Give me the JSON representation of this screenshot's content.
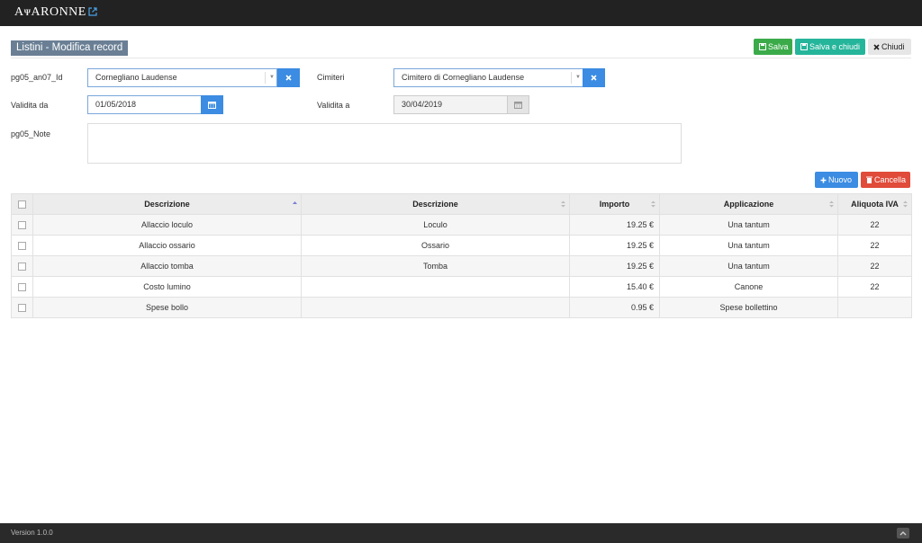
{
  "app": {
    "logo": "AᴪARONNE",
    "version": "Version 1.0.0"
  },
  "page": {
    "title": "Listini - Modifica record"
  },
  "toolbar": {
    "save_label": "Salva",
    "save_close_label": "Salva e chiudi",
    "close_label": "Chiudi"
  },
  "form": {
    "an07_label": "pg05_an07_Id",
    "an07_value": "Cornegliano Laudense",
    "cimiteri_label": "Cimiteri",
    "cimiteri_value": "Cimitero di Cornegliano Laudense",
    "validita_da_label": "Validita da",
    "validita_da_value": "01/05/2018",
    "validita_a_label": "Validita a",
    "validita_a_value": "30/04/2019",
    "note_label": "pg05_Note",
    "note_value": ""
  },
  "grid_toolbar": {
    "new_label": "Nuovo",
    "delete_label": "Cancella"
  },
  "table": {
    "columns": [
      "Descrizione",
      "Descrizione",
      "Importo",
      "Applicazione",
      "Aliquota IVA"
    ],
    "rows": [
      [
        "Allaccio loculo",
        "Loculo",
        "19.25 €",
        "Una tantum",
        "22"
      ],
      [
        "Allaccio ossario",
        "Ossario",
        "19.25 €",
        "Una tantum",
        "22"
      ],
      [
        "Allaccio tomba",
        "Tomba",
        "19.25 €",
        "Una tantum",
        "22"
      ],
      [
        "Costo lumino",
        "",
        "15.40 €",
        "Canone",
        "22"
      ],
      [
        "Spese bollo",
        "",
        "0.95 €",
        "Spese bollettino",
        ""
      ]
    ]
  },
  "colors": {
    "primary": "#3b8ce2",
    "success": "#3bab4a",
    "teal": "#25b59b",
    "danger": "#e04b3a",
    "title_bg": "#6a7f94"
  }
}
